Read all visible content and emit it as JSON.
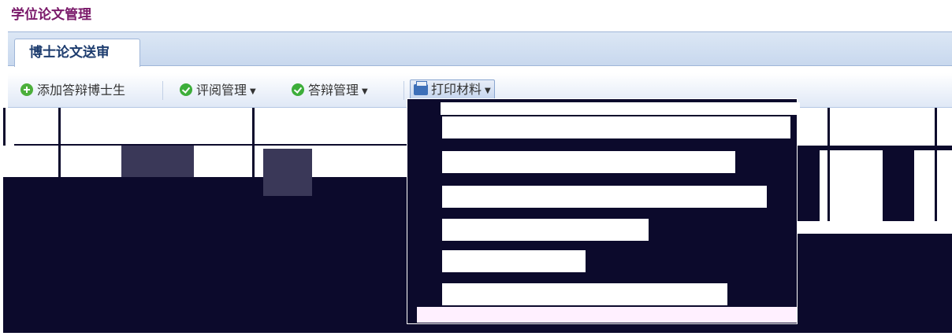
{
  "app_title": "学位论文管理",
  "tabs": [
    {
      "label": "博士论文送审",
      "active": true
    }
  ],
  "toolbar": {
    "add_label": "添加答辩博士生",
    "review_label": "评阅管理",
    "defense_label": "答辩管理",
    "print_label": "打印材料"
  },
  "colors": {
    "title": "#7a1a6a",
    "tab_text": "#1d3c6e",
    "dark_fill": "#0c0a2c",
    "toolbar_bg": "#dfe8f6"
  },
  "icons": [
    "add-icon",
    "check-icon",
    "check-icon",
    "printer-icon",
    "chevron-down-icon"
  ]
}
